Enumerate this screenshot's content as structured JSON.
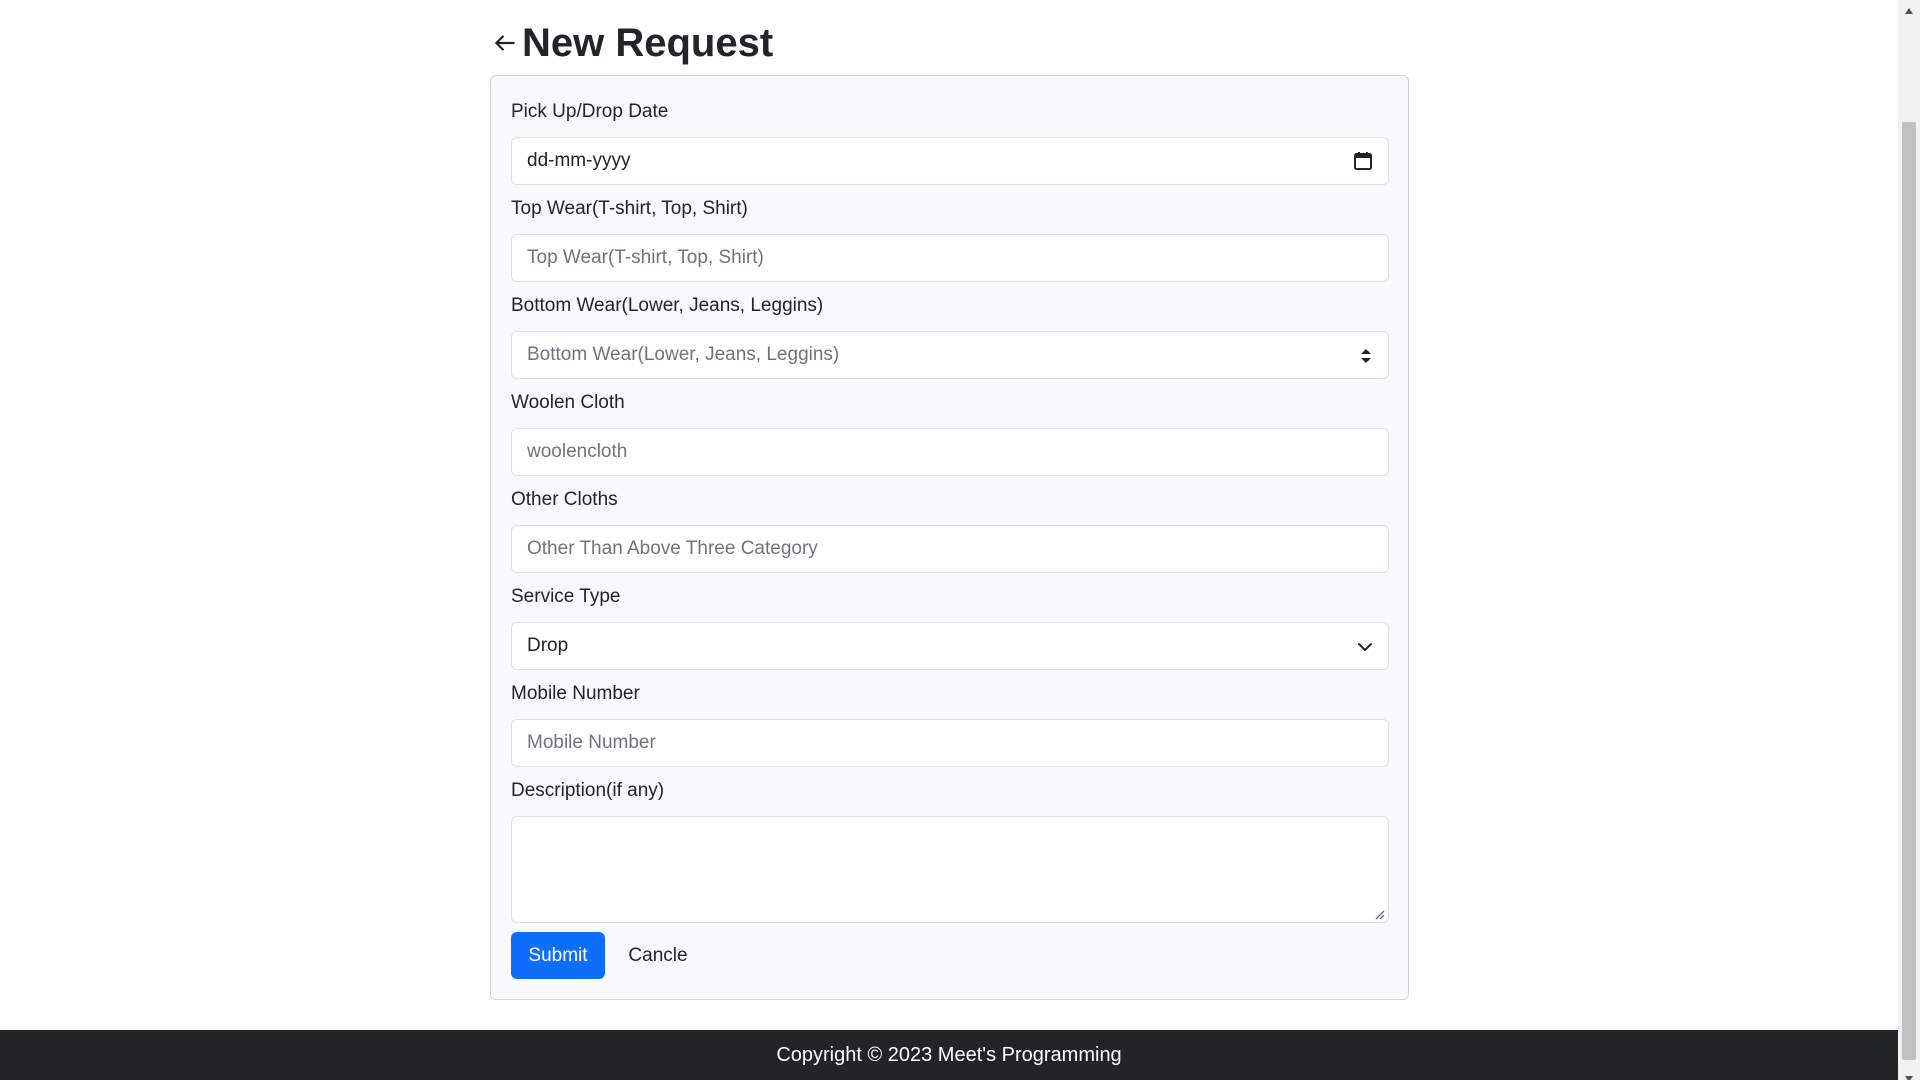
{
  "header": {
    "title": "New Request",
    "back_icon": "arrow-left-icon"
  },
  "form": {
    "pickup_date": {
      "label": "Pick Up/Drop Date",
      "placeholder": "dd-mm-yyyy",
      "icon": "calendar-icon"
    },
    "top_wear": {
      "label": "Top Wear(T-shirt, Top, Shirt)",
      "placeholder": "Top Wear(T-shirt, Top, Shirt)"
    },
    "bottom_wear": {
      "label": "Bottom Wear(Lower, Jeans, Leggins)",
      "placeholder": "Bottom Wear(Lower, Jeans, Leggins)",
      "icon": "spinner-arrows-icon"
    },
    "woolen_cloth": {
      "label": "Woolen Cloth",
      "placeholder": "woolencloth"
    },
    "other_cloths": {
      "label": "Other Cloths",
      "placeholder": "Other Than Above Three Category"
    },
    "service_type": {
      "label": "Service Type",
      "selected": "Drop",
      "icon": "chevron-down-icon"
    },
    "mobile_number": {
      "label": "Mobile Number",
      "placeholder": "Mobile Number"
    },
    "description": {
      "label": "Description(if any)",
      "value": ""
    },
    "submit_label": "Submit",
    "cancel_label": "Cancle"
  },
  "footer": {
    "text": "Copyright © 2023 Meet's Programming"
  },
  "colors": {
    "primary": "#0d6efd",
    "footer_bg": "#212529",
    "card_bg": "#f8f9fa"
  }
}
